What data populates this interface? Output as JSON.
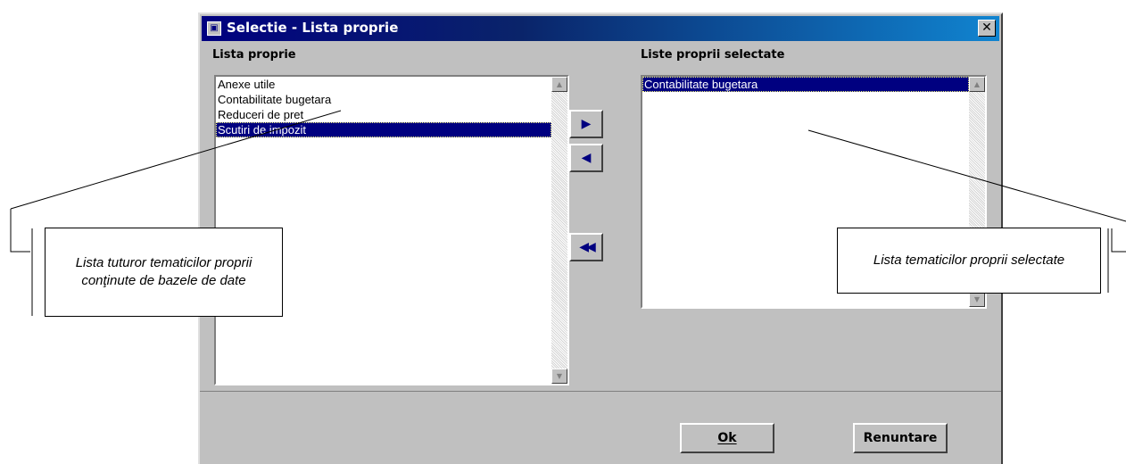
{
  "window": {
    "title": "Selectie - Lista proprie",
    "close_glyph": "✕"
  },
  "left_panel": {
    "label": "Lista proprie",
    "items": [
      {
        "text": "Anexe utile",
        "selected": false
      },
      {
        "text": "Contabilitate bugetara",
        "selected": false
      },
      {
        "text": "Reduceri de pret",
        "selected": false
      },
      {
        "text": "Scutiri de impozit",
        "selected": true
      }
    ]
  },
  "right_panel": {
    "label": "Liste proprii selectate",
    "items": [
      {
        "text": "Contabilitate bugetara",
        "selected": true
      }
    ]
  },
  "move_buttons": {
    "add_glyph": "▶",
    "remove_glyph": "◀",
    "remove_all_glyph": "◀◀"
  },
  "buttons": {
    "ok_label": "Ok",
    "cancel_label": "Renuntare"
  },
  "annotations": {
    "left": "Lista tuturor tematicilor proprii conţinute de bazele de date",
    "right": "Lista tematicilor proprii selectate"
  },
  "colors": {
    "selection": "#000080",
    "face": "#c0c0c0"
  }
}
